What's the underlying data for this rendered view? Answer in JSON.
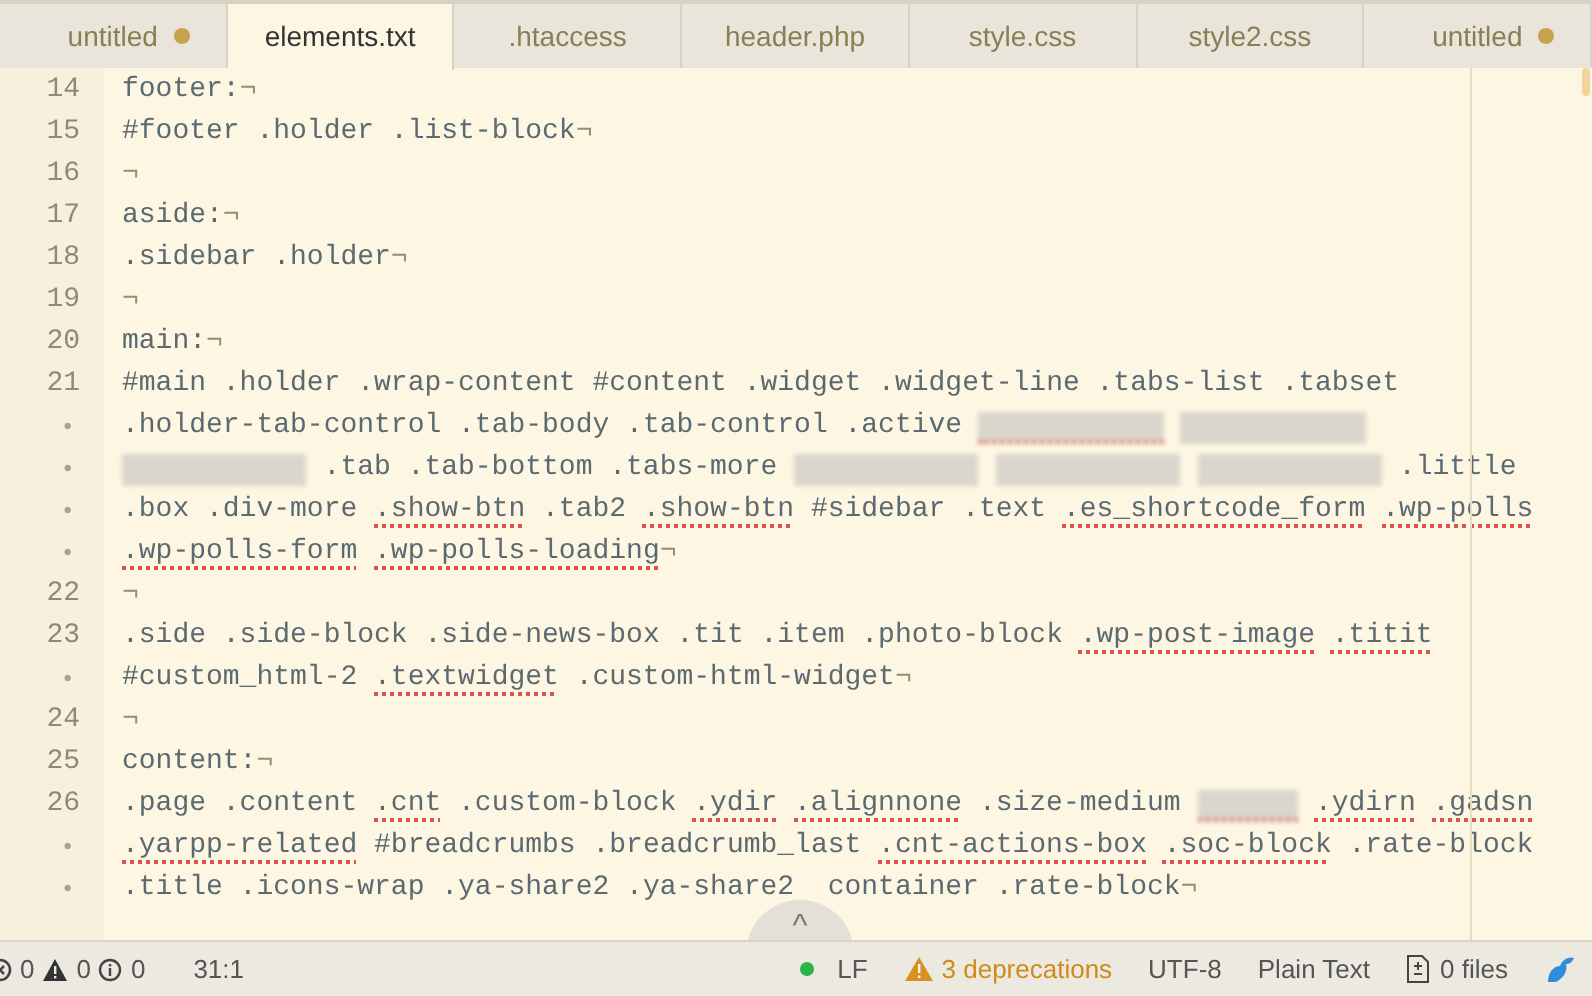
{
  "tabs": [
    {
      "label": "untitled",
      "selected": false,
      "modified": true
    },
    {
      "label": "elements.txt",
      "selected": true,
      "modified": false
    },
    {
      "label": ".htaccess",
      "selected": false,
      "modified": false
    },
    {
      "label": "header.php",
      "selected": false,
      "modified": false
    },
    {
      "label": "style.css",
      "selected": false,
      "modified": false
    },
    {
      "label": "style2.css",
      "selected": false,
      "modified": false
    },
    {
      "label": "untitled",
      "selected": false,
      "modified": true
    }
  ],
  "editor": {
    "eol_mark": "¬",
    "lines": [
      {
        "gutter": "14",
        "eol": true,
        "tokens": [
          {
            "text": "footer:"
          }
        ]
      },
      {
        "gutter": "15",
        "eol": true,
        "tokens": [
          {
            "text": "#footer .holder .list-block"
          }
        ]
      },
      {
        "gutter": "16",
        "eol": true
      },
      {
        "gutter": "17",
        "eol": true,
        "tokens": [
          {
            "text": "aside:"
          }
        ]
      },
      {
        "gutter": "18",
        "eol": true,
        "tokens": [
          {
            "text": ".sidebar .holder"
          }
        ]
      },
      {
        "gutter": "19",
        "eol": true
      },
      {
        "gutter": "20",
        "eol": true,
        "tokens": [
          {
            "text": "main:"
          }
        ]
      },
      {
        "gutter": "21",
        "eol": false,
        "tokens": [
          {
            "text": "#main .holder .wrap-content #content .widget .widget-line .tabs-list .tabset"
          }
        ]
      },
      {
        "gutter": "•",
        "eol": false,
        "tokens": [
          {
            "text": ".holder-tab-control .tab-body .tab-control .active"
          },
          {
            "kind": "blurred",
            "misspelled": true
          },
          {
            "kind": "blurred",
            "misspelled": false
          }
        ]
      },
      {
        "gutter": "•",
        "eol": false,
        "tokens": [
          {
            "kind": "blurred",
            "misspelled": false
          },
          {
            "text": ".tab .tab-bottom .tabs-more"
          },
          {
            "kind": "blurred",
            "misspelled": false
          },
          {
            "kind": "blurred",
            "misspelled": false
          },
          {
            "kind": "blurred",
            "misspelled": false
          },
          {
            "text": ".little"
          }
        ]
      },
      {
        "gutter": "•",
        "eol": false,
        "tokens": [
          {
            "text": ".box .div-more"
          },
          {
            "text": ".show-btn",
            "misspelled": true
          },
          {
            "text": ".tab2"
          },
          {
            "text": ".show-btn",
            "misspelled": true
          },
          {
            "text": "#sidebar .text"
          },
          {
            "text": ".es_shortcode_form",
            "misspelled": true
          },
          {
            "text": ".wp-polls",
            "misspelled": true
          }
        ]
      },
      {
        "gutter": "•",
        "eol": true,
        "tokens": [
          {
            "text": ".wp-polls-form",
            "misspelled": true
          },
          {
            "text": ".wp-polls-loading",
            "misspelled": true
          }
        ]
      },
      {
        "gutter": "22",
        "eol": true
      },
      {
        "gutter": "23",
        "eol": false,
        "tokens": [
          {
            "text": ".side .side-block .side-news-box .tit .item .photo-block"
          },
          {
            "text": ".wp-post-image",
            "misspelled": true
          },
          {
            "text": ".titit",
            "misspelled": true
          }
        ]
      },
      {
        "gutter": "•",
        "eol": true,
        "tokens": [
          {
            "text": "#custom_html-2"
          },
          {
            "text": ".textwidget",
            "misspelled": true
          },
          {
            "text": ".custom-html-widget"
          }
        ]
      },
      {
        "gutter": "24",
        "eol": true
      },
      {
        "gutter": "25",
        "eol": true,
        "tokens": [
          {
            "text": "content:"
          }
        ]
      },
      {
        "gutter": "26",
        "eol": false,
        "tokens": [
          {
            "text": ".page .content"
          },
          {
            "text": ".cnt",
            "misspelled": true
          },
          {
            "text": ".custom-block"
          },
          {
            "text": ".ydir",
            "misspelled": true
          },
          {
            "text": ".alignnone",
            "misspelled": true
          },
          {
            "text": ".size-medium"
          },
          {
            "kind": "blurred_short",
            "misspelled": true
          },
          {
            "text": ".ydirn",
            "misspelled": true
          },
          {
            "text": ".gadsn",
            "misspelled": true
          }
        ]
      },
      {
        "gutter": "•",
        "eol": false,
        "tokens": [
          {
            "text": ".yarpp-related",
            "misspelled": true
          },
          {
            "text": "#breadcrumbs .breadcrumb_last"
          },
          {
            "text": ".cnt-actions-box",
            "misspelled": true
          },
          {
            "text": ".soc-block",
            "misspelled": true
          },
          {
            "text": ".rate-block"
          }
        ]
      },
      {
        "gutter": "•",
        "eol": true,
        "tokens": [
          {
            "text": ".title .icons-wrap .ya-share2 .ya-share2"
          },
          {
            "kind": "covered"
          },
          {
            "text": "container .rate-block"
          }
        ]
      }
    ]
  },
  "scroll_top_button": {
    "label": "^"
  },
  "status_bar": {
    "errors": "0",
    "warnings": "0",
    "infos": "0",
    "cursor": "31:1",
    "line_ending": "LF",
    "deprecations": "3 deprecations",
    "encoding": "UTF-8",
    "grammar": "Plain Text",
    "files": "0 files"
  }
}
